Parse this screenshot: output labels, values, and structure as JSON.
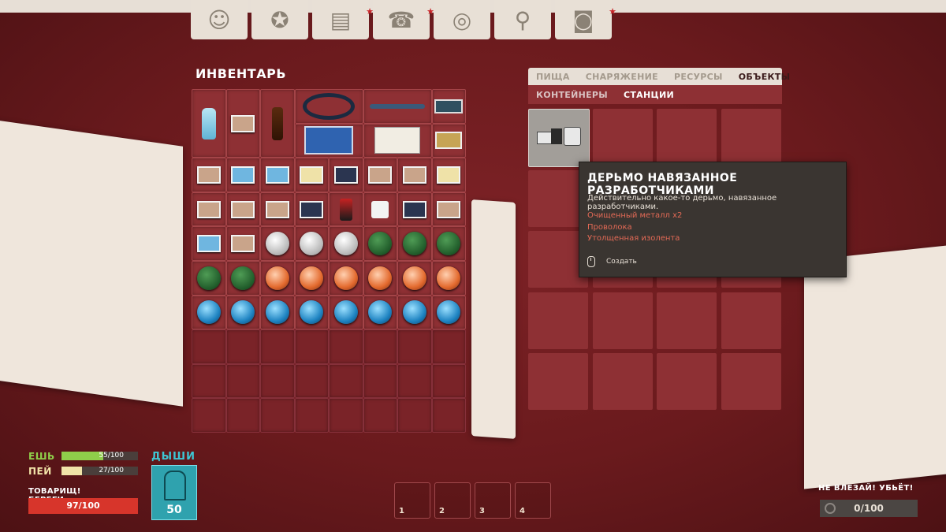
{
  "top_tabs": [
    {
      "icon": "character-icon",
      "glyph": "☺",
      "starred": false
    },
    {
      "icon": "medal-icon",
      "glyph": "✪",
      "starred": false
    },
    {
      "icon": "journal-icon",
      "glyph": "▤",
      "starred": true
    },
    {
      "icon": "phone-icon",
      "glyph": "☎",
      "starred": true
    },
    {
      "icon": "tape-icon",
      "glyph": "◎",
      "starred": false
    },
    {
      "icon": "map-pin-icon",
      "glyph": "⚲",
      "starred": false
    },
    {
      "icon": "camera-icon",
      "glyph": "◙",
      "starred": true
    }
  ],
  "inventory": {
    "title": "ИНВЕНТАРЬ"
  },
  "crafting": {
    "tabs": [
      "ПИЩА",
      "СНАРЯЖЕНИЕ",
      "РЕСУРСЫ",
      "ОБЪЕКТЫ"
    ],
    "active_tab": "ОБЪЕКТЫ",
    "subtabs": [
      "КОНТЕЙНЕРЫ",
      "СТАНЦИИ"
    ],
    "active_subtab": "СТАНЦИИ"
  },
  "tooltip": {
    "title": "ДЕРЬМО НАВЯЗАННОЕ РАЗРАБОТЧИКАМИ",
    "description": "Действительно какое-то дерьмо, навязанное разработчиками.",
    "requirements": [
      "Очищенный металл x2",
      "Проволока",
      "Утолщенная изолента"
    ],
    "action": "Создать"
  },
  "hud": {
    "eat_label": "ЕШЬ",
    "eat_value": "55/100",
    "eat_fraction": 0.55,
    "drink_label": "ПЕЙ",
    "drink_value": "27/100",
    "drink_fraction": 0.27,
    "warning": "ТОВАРИЩ! БЕРЕГИ СВОЁ",
    "health_value": "97/100",
    "breathe_label": "ДЫШИ",
    "breathe_value": "50"
  },
  "hotbar": [
    "1",
    "2",
    "3",
    "4"
  ],
  "capacity": {
    "warning": "НЕ ВЛЕЗАЙ! УБЬЁТ!",
    "value": "0/100"
  },
  "colors": {
    "eat": "#8fce4a",
    "drink": "#f1e3a8",
    "health": "#d7352b",
    "breathe": "#3dc6d4"
  }
}
